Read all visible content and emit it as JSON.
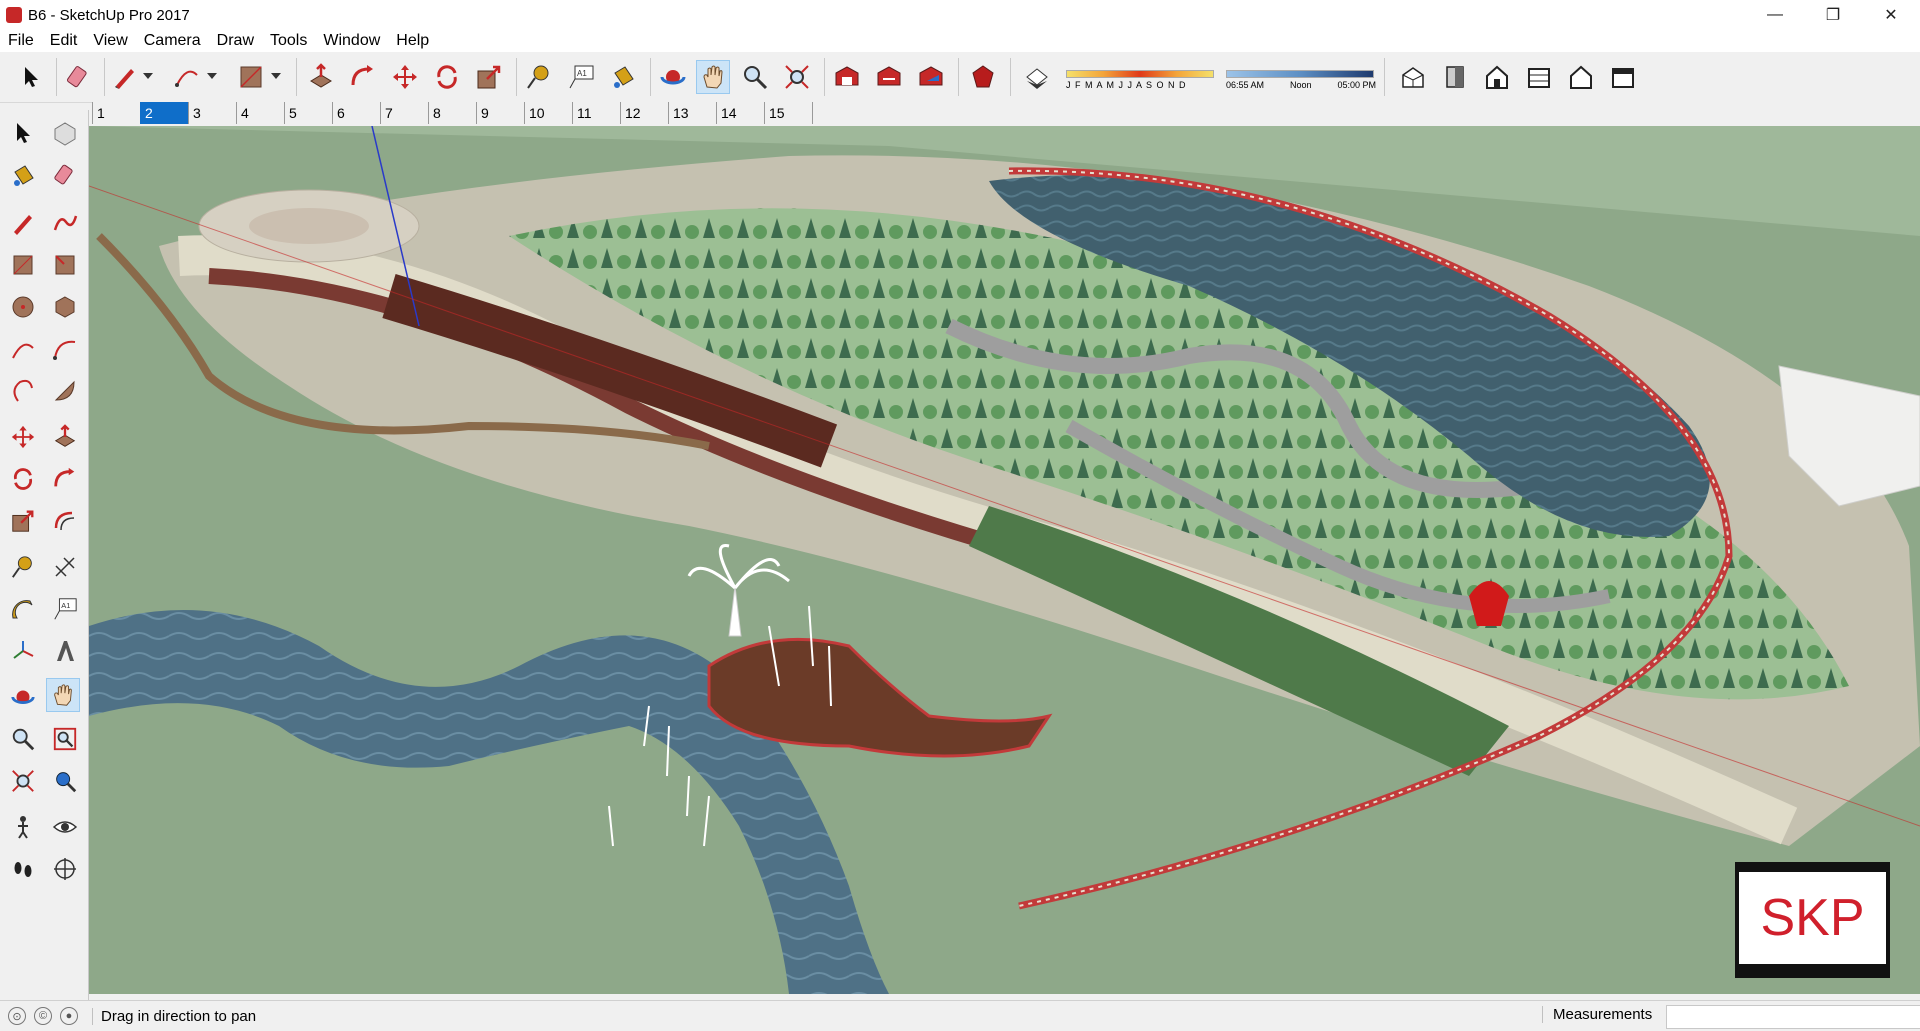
{
  "window": {
    "title": "B6 - SketchUp Pro 2017",
    "minimize": "—",
    "maximize": "❐",
    "close": "✕"
  },
  "menu": [
    "File",
    "Edit",
    "View",
    "Camera",
    "Draw",
    "Tools",
    "Window",
    "Help"
  ],
  "shadows": {
    "months": "J F M A M J J A S O N D",
    "time_start": "06:55 AM",
    "time_mid": "Noon",
    "time_end": "05:00 PM"
  },
  "scenes": [
    "1",
    "2",
    "3",
    "4",
    "5",
    "6",
    "7",
    "8",
    "9",
    "10",
    "11",
    "12",
    "13",
    "14",
    "15"
  ],
  "active_scene": "2",
  "status": {
    "hint": "Drag in direction to pan",
    "measurements_label": "Measurements",
    "measurements_value": ""
  },
  "badge": {
    "text": "SKP"
  },
  "colors": {
    "accent": "#0f6ec9",
    "water": "#4d6e80",
    "bridge": "#c23a3a",
    "grass": "#8fa68a"
  }
}
